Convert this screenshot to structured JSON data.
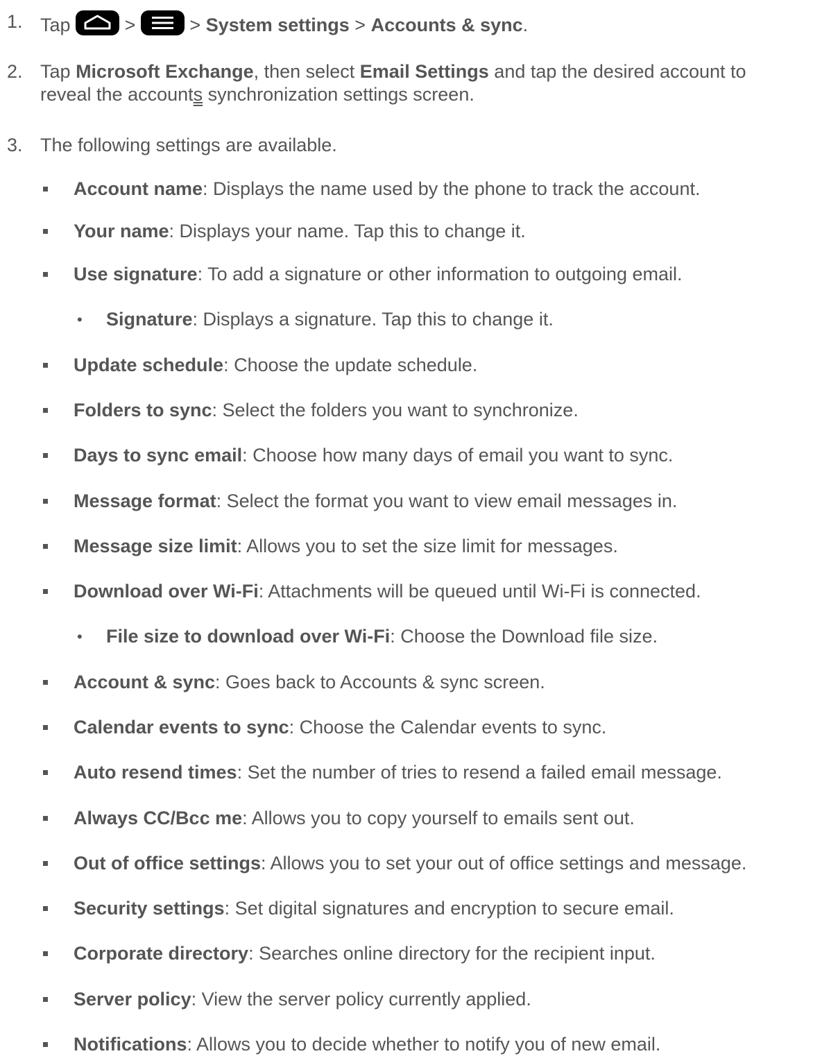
{
  "steps": [
    {
      "num": "1.",
      "t1": "Tap",
      "sep1": ">",
      "sep2": ">",
      "b1": "System settings",
      "sep3": ">",
      "b2": "Accounts & sync",
      "end": "."
    },
    {
      "num": "2.",
      "t1": "Tap",
      "b1": "Microsoft Exchange",
      "t2": ", then select",
      "b2": "Email Settings",
      "t3": "and tap the desired account to",
      "line2_a": "reveal the account",
      "line2_u": "s",
      "line2_b": " synchronization settings screen."
    },
    {
      "num": "3.",
      "text": "The following settings are available."
    }
  ],
  "icons": [
    "home-icon",
    "menu-icon"
  ],
  "items": [
    {
      "label": "Account name",
      "desc": ": Displays the name used by the phone to track the account."
    },
    {
      "label": "Your name",
      "desc": ": Displays your name. Tap this to change it."
    },
    {
      "label": "Use signature",
      "desc": ": To add a signature or other information to outgoing email."
    },
    {
      "label": "Signature",
      "desc": ": Displays a signature. Tap this to change it."
    },
    {
      "label": "Update schedule",
      "desc": ": Choose the update schedule."
    },
    {
      "label": "Folders to sync",
      "desc": ": Select the folders you want to synchronize."
    },
    {
      "label": "Days to sync email",
      "desc": ": Choose how many days of email you want to sync."
    },
    {
      "label": "Message format",
      "desc": ": Select the format you want to view email messages in."
    },
    {
      "label": "Message size limit",
      "desc": ": Allows you to set the size limit for messages."
    },
    {
      "label": "Download over Wi-Fi",
      "desc": ": Attachments will be queued until Wi-Fi is connected."
    },
    {
      "label": "File size to download over Wi-Fi",
      "desc": ": Choose the Download file size."
    },
    {
      "label": "Account & sync",
      "desc": ": Goes back to Accounts & sync screen."
    },
    {
      "label": "Calendar events to sync",
      "desc": ": Choose the Calendar events to sync."
    },
    {
      "label": "Auto resend times",
      "desc": ": Set the number of tries to resend a failed email message."
    },
    {
      "label": "Always CC/Bcc me",
      "desc": ": Allows you to copy yourself to emails sent out."
    },
    {
      "label": "Out of office settings",
      "desc": ": Allows you to set your out of office settings and message."
    },
    {
      "label": "Security settings",
      "desc": ": Set digital signatures and encryption to secure email."
    },
    {
      "label": "Corporate directory",
      "desc": ": Searches online directory for the recipient input."
    },
    {
      "label": "Server policy",
      "desc": ": View the server policy currently applied."
    },
    {
      "label": "Notifications",
      "desc": ": Allows you to decide whether to notify you of new email."
    }
  ],
  "bullets": {
    "square": "▪",
    "dot": "•"
  }
}
